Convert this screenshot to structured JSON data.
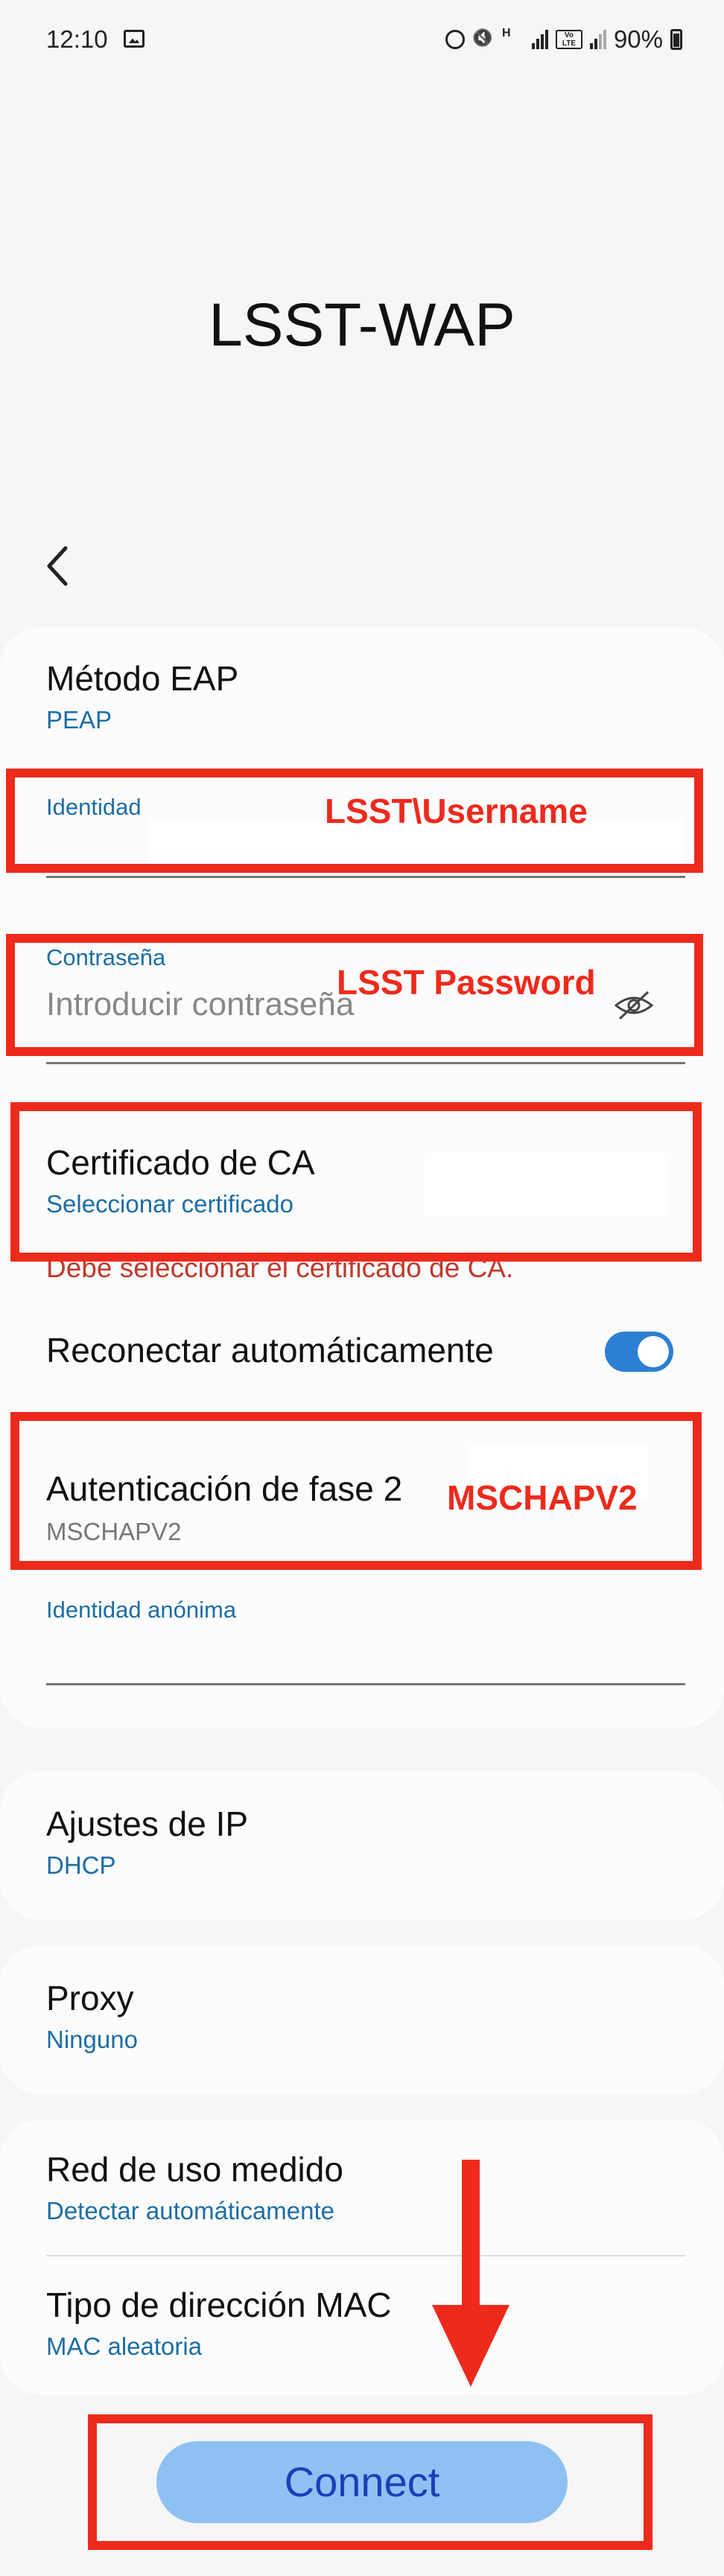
{
  "status_bar": {
    "time": "12:10",
    "network_h": "H",
    "volte": "Vo LTE",
    "battery": "90%"
  },
  "header": {
    "title": "LSST-WAP"
  },
  "eap": {
    "label": "Método EAP",
    "value": "PEAP"
  },
  "identity": {
    "label": "Identidad",
    "annotation": "LSST\\Username"
  },
  "password": {
    "label": "Contraseña",
    "placeholder": "Introducir contraseña",
    "annotation": "LSST Password"
  },
  "ca_cert": {
    "label": "Certificado de CA",
    "value": "Seleccionar certificado",
    "error": "Debe seleccionar el certificado de CA."
  },
  "auto_reconnect": {
    "label": "Reconectar automáticamente",
    "enabled": true
  },
  "phase2": {
    "label": "Autenticación de fase 2",
    "value": "MSCHAPV2",
    "annotation": "MSCHAPV2"
  },
  "anon_identity": {
    "label": "Identidad anónima"
  },
  "ip_settings": {
    "label": "Ajustes de IP",
    "value": "DHCP"
  },
  "proxy": {
    "label": "Proxy",
    "value": "Ninguno"
  },
  "metered": {
    "label": "Red de uso medido",
    "value": "Detectar automáticamente"
  },
  "mac": {
    "label": "Tipo de dirección MAC",
    "value": "MAC aleatoria"
  },
  "footer": {
    "connect_label": "Connect"
  },
  "colors": {
    "annotation_red": "#ee2a1c",
    "accent_blue": "#1c6ea4",
    "toggle_blue": "#2b7fd4",
    "button_bg": "#8ec1f3"
  }
}
